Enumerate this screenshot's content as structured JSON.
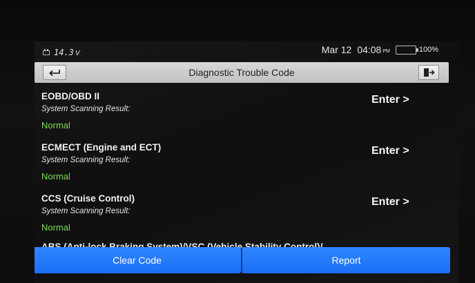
{
  "status_bar": {
    "voltage": "14.3",
    "voltage_unit": "V",
    "date": "Mar 12",
    "time": "04:08",
    "ampm": "PM",
    "battery_percent": "100%",
    "battery_color": "#39d12f"
  },
  "header": {
    "title": "Diagnostic Trouble Code",
    "back_icon": "back-arrow-icon",
    "exit_icon": "exit-door-icon"
  },
  "systems": [
    {
      "name": "EOBD/OBD II",
      "scan_label": "System Scanning Result:",
      "result": "Normal",
      "action": "Enter >"
    },
    {
      "name": "ECMECT (Engine and ECT)",
      "scan_label": "System Scanning Result:",
      "result": "Normal",
      "action": "Enter >"
    },
    {
      "name": "CCS (Cruise Control)",
      "scan_label": "System Scanning Result:",
      "result": "Normal",
      "action": "Enter >"
    }
  ],
  "partial_system": {
    "name": "ABS (Anti-lock Braking System)/VSC (Vehicle Stability Control)/"
  },
  "footer": {
    "clear_label": "Clear Code",
    "report_label": "Report",
    "accent_color": "#2b80ff"
  }
}
